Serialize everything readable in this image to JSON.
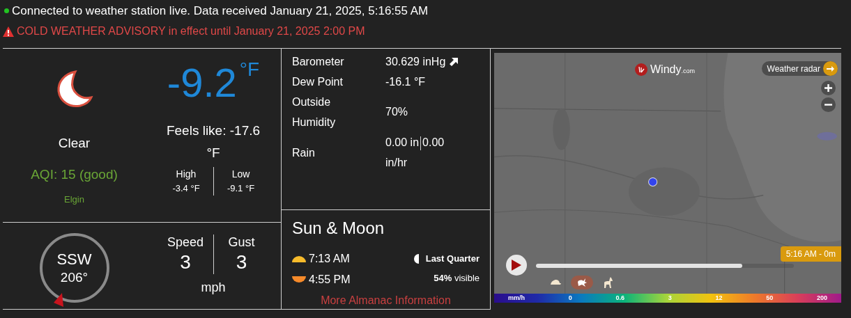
{
  "status": {
    "connected": true,
    "text": "Connected to weather station live. Data received January 21, 2025, 5:16:55 AM"
  },
  "alert": {
    "text": "COLD WEATHER ADVISORY in effect until January 21, 2025 2:00 PM"
  },
  "current": {
    "condition": "Clear",
    "temperature": "-9.2",
    "unit": "°F",
    "feels_like": "Feels like: -17.6 °F",
    "aqi": "AQI: 15 (good)",
    "location": "Elgin",
    "extremes": [
      {
        "label": "High",
        "value": "-3.4 °F"
      },
      {
        "label": "Low",
        "value": "-9.1 °F"
      }
    ]
  },
  "wind": {
    "direction": "SSW",
    "degrees": "206°",
    "measures": [
      {
        "label": "Speed",
        "value": "3"
      },
      {
        "label": "Gust",
        "value": "3"
      }
    ],
    "unit": "mph"
  },
  "readings": [
    {
      "kind": "rising",
      "label": "Barometer",
      "value": "30.629 inHg"
    },
    {
      "kind": "plain",
      "label": "Dew Point",
      "value": "-16.1 °F"
    },
    {
      "kind": "plain",
      "label": "Outside Humidity",
      "value": "70%"
    },
    {
      "kind": "split",
      "label": "Rain",
      "value": "0.00 in",
      "value_2": "0.00 in/hr"
    }
  ],
  "sun_moon": {
    "title": "Sun & Moon",
    "times": [
      {
        "kind": "sunrise",
        "text": "7:13 AM"
      },
      {
        "kind": "sunset",
        "text": "4:55 PM"
      }
    ],
    "moon_phase": "Last Quarter",
    "visible_percent": "54%",
    "visible_label": "visible",
    "link": "More Almanac Information"
  },
  "map": {
    "logo": "Windy",
    "logo_suffix": ".com",
    "layer_button": "Weather radar",
    "time": "5:16 AM - 0m",
    "level": 0.8,
    "speeds": [
      {
        "kind": "slow",
        "selected": false
      },
      {
        "kind": "normal",
        "selected": true
      },
      {
        "kind": "fast",
        "selected": false
      }
    ],
    "legend": [
      "mm/h",
      "0",
      "0.6",
      "3",
      "12",
      "50",
      "200"
    ]
  }
}
